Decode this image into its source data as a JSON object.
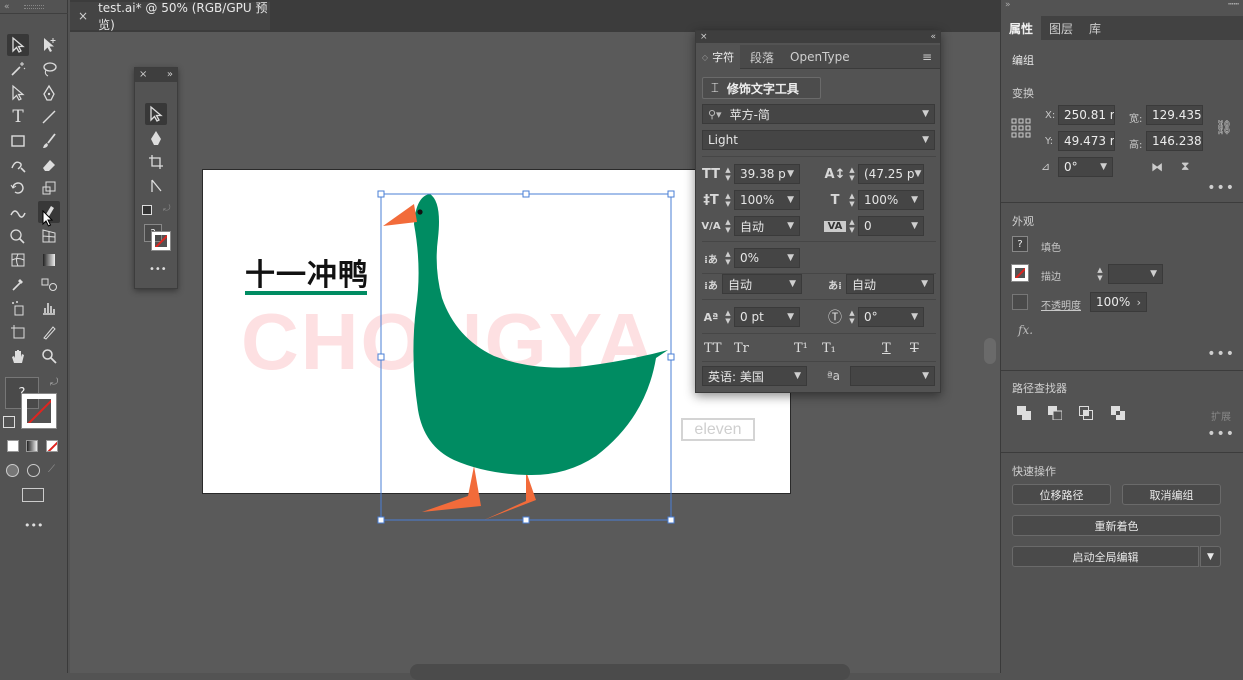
{
  "document": {
    "tab_title": "test.ai* @ 50% (RGB/GPU 预览)",
    "close_glyph": "×"
  },
  "artwork": {
    "title": "十一冲鸭",
    "bg_text": "CHONGYA",
    "tag_text": "eleven",
    "colors": {
      "duck": "#008c62",
      "beak": "#f26b3a",
      "underline": "#008c62",
      "bg_text": "#fde0e2",
      "selection": "#4a7fd6"
    }
  },
  "char_panel": {
    "tabs": [
      "字符",
      "段落",
      "OpenType"
    ],
    "touch_type_tool": "修饰文字工具",
    "font_family": "苹方-简",
    "font_style": "Light",
    "font_size": "39.38 p",
    "leading": "(47.25 p",
    "vertical_scale": "100%",
    "horizontal_scale": "100%",
    "kerning": "自动",
    "tracking": "0",
    "tsume": "0%",
    "aki_left": "自动",
    "aki_right": "自动",
    "baseline_shift": "0 pt",
    "rotation": "0°",
    "style_buttons": [
      "TT",
      "Tr",
      "T¹",
      "T₁",
      "T",
      "T"
    ],
    "language": "英语: 美国",
    "aa_label": "ªa"
  },
  "props": {
    "tabs": [
      "属性",
      "图层",
      "库"
    ],
    "selection_type": "编组",
    "transform": {
      "title": "变换",
      "x_label": "X:",
      "x": "250.81 r",
      "y_label": "Y:",
      "y": "49.473 r",
      "w_label": "宽:",
      "w": "129.435",
      "h_label": "高:",
      "h": "146.238",
      "angle": "0°"
    },
    "appearance": {
      "title": "外观",
      "fill_label": "填色",
      "stroke_label": "描边",
      "opacity_label": "不透明度",
      "opacity": "100%",
      "fx": "fx."
    },
    "pathfinder": {
      "title": "路径查找器",
      "expand": "扩展"
    },
    "quick_actions": {
      "title": "快速操作",
      "offset_path": "位移路径",
      "ungroup": "取消编组",
      "recolor": "重新着色",
      "global_edit": "启动全局编辑"
    }
  },
  "toolbar": {
    "more": "•••",
    "unknown_swatch": "?"
  }
}
